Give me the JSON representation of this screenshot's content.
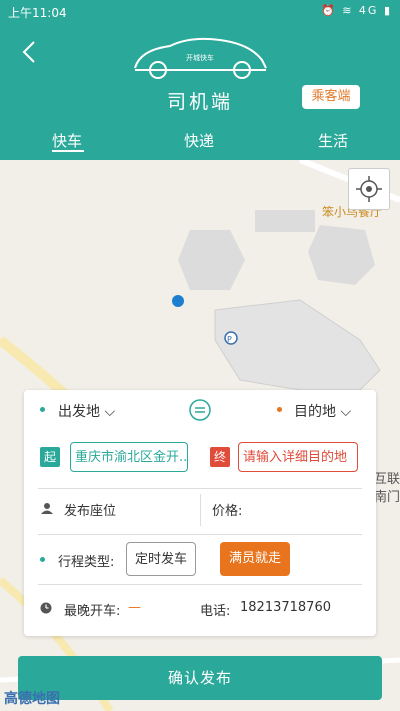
{
  "status": {
    "time": "上午11:04",
    "icons": "⏰ ≋ 4G ▮"
  },
  "header": {
    "logo_text": "开城快车",
    "title": "司机端",
    "passenger_btn": "乘客端",
    "tabs": [
      "快车",
      "快递",
      "生活"
    ]
  },
  "map": {
    "poi_label": "笨小鸟餐厅",
    "poi_label2": "互联",
    "poi_label3": "南门",
    "map_brand": "高德地图",
    "parking": "P"
  },
  "form": {
    "from_label": "出发地",
    "to_label": "目的地",
    "start_tag": "起",
    "end_tag": "终",
    "start_address": "重庆市渝北区金开...",
    "end_placeholder": "请输入详细目的地",
    "seats_label": "发布座位",
    "price_label": "价格:",
    "trip_type_label": "行程类型:",
    "trip_option_1": "定时发车",
    "trip_option_2": "满员就走",
    "latest_label": "最晚开车:",
    "latest_value": "—",
    "phone_label": "电话:",
    "phone_value": "18213718760"
  },
  "confirm_label": "确认发布",
  "colors": {
    "teal": "#2aa99a",
    "orange": "#e8741e",
    "red": "#e04b3a"
  }
}
